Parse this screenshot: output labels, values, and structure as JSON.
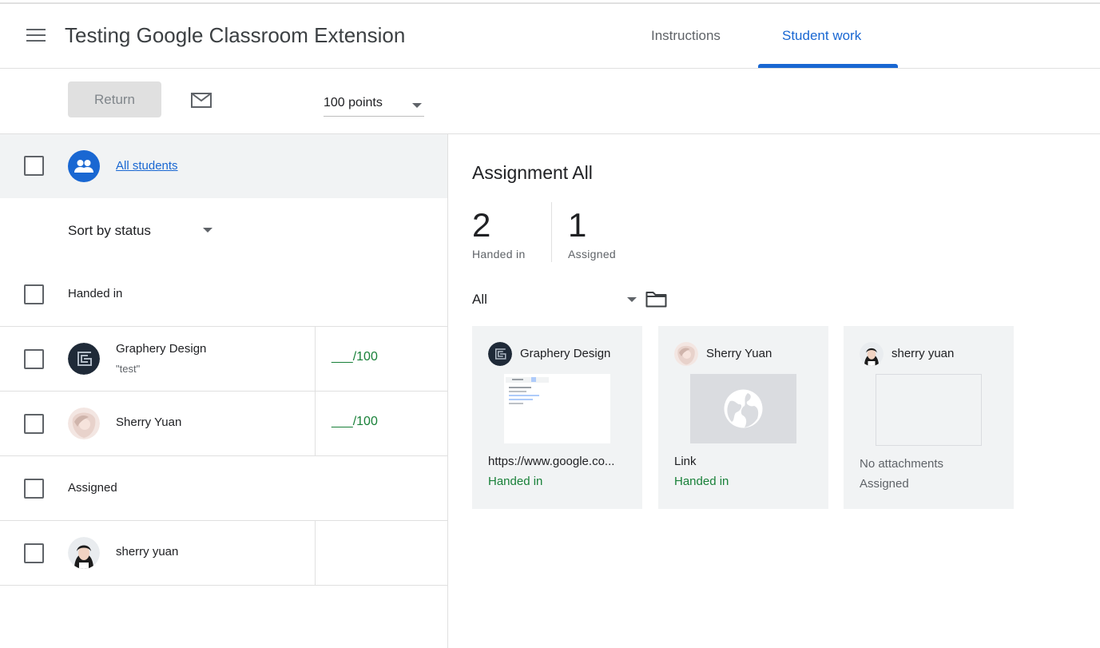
{
  "header": {
    "title": "Testing Google Classroom Extension",
    "tabs": [
      {
        "label": "Instructions",
        "active": false
      },
      {
        "label": "Student work",
        "active": true
      }
    ]
  },
  "toolbar": {
    "return_label": "Return",
    "points_value": "100 points"
  },
  "left": {
    "all_students_label": "All students",
    "sort_label": "Sort by status",
    "sections": [
      {
        "label": "Handed in",
        "students": [
          {
            "name": "Graphery Design",
            "sub": "\"test\"",
            "grade": "___/100"
          },
          {
            "name": "Sherry Yuan",
            "sub": "",
            "grade": "___/100"
          }
        ]
      },
      {
        "label": "Assigned",
        "students": [
          {
            "name": "sherry yuan",
            "sub": "",
            "grade": ""
          }
        ]
      }
    ]
  },
  "right": {
    "title": "Assignment All",
    "stats": [
      {
        "value": "2",
        "label": "Handed in"
      },
      {
        "value": "1",
        "label": "Assigned"
      }
    ],
    "filter_value": "All",
    "cards": [
      {
        "name": "Graphery Design",
        "attachment": "https://www.google.co...",
        "status": "Handed in",
        "thumb": "doc-preview"
      },
      {
        "name": "Sherry Yuan",
        "attachment": "Link",
        "status": "Handed in",
        "thumb": "globe-icon"
      },
      {
        "name": "sherry yuan",
        "attachment": "No attachments",
        "status": "Assigned",
        "thumb": "empty"
      }
    ]
  },
  "colors": {
    "accent": "#1967d2",
    "success": "#188038",
    "muted": "#5f6368"
  }
}
